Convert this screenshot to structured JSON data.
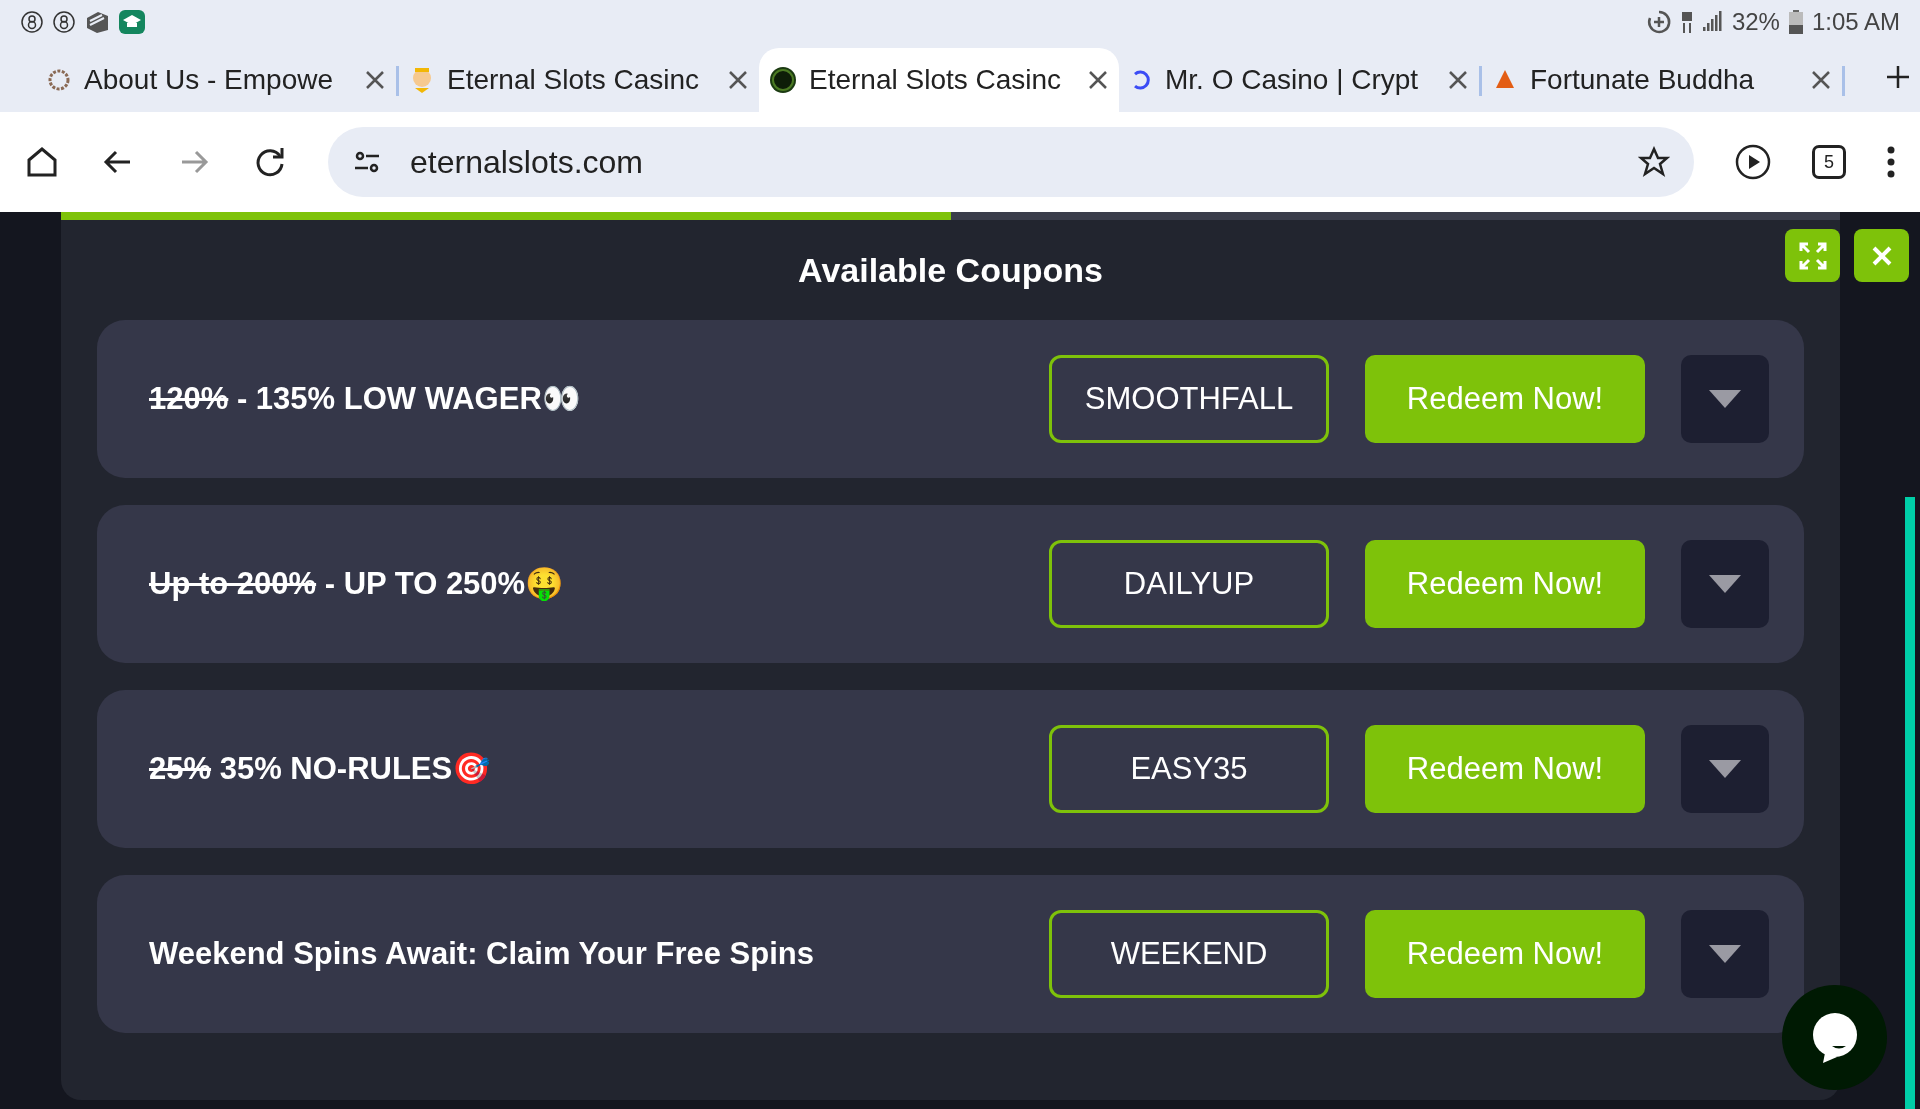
{
  "status_bar": {
    "battery": "32%",
    "time": "1:05 AM"
  },
  "tabs": [
    {
      "title": "About Us - Empowe",
      "selected": false
    },
    {
      "title": "Eternal Slots Casinc",
      "selected": false
    },
    {
      "title": "Eternal Slots Casinc",
      "selected": true
    },
    {
      "title": "Mr. O Casino | Crypt",
      "selected": false
    },
    {
      "title": "Fortunate Buddha",
      "selected": false
    }
  ],
  "address_bar": {
    "url": "eternalslots.com",
    "tab_count": "5"
  },
  "modal": {
    "progress": {
      "level": 0.5
    },
    "title": "Available Coupons",
    "coupons": [
      {
        "old": "120%",
        "title": " - 135% LOW WAGER👀",
        "code": "SMOOTHFALL",
        "button": "Redeem Now!"
      },
      {
        "old": "Up to 200%",
        "title": " - UP TO 250%🤑",
        "code": "DAILYUP",
        "button": "Redeem Now!"
      },
      {
        "old": "25%",
        "title": " 35% NO-RULES🎯",
        "code": "EASY35",
        "button": "Redeem Now!"
      },
      {
        "title": "Weekend Spins Await: Claim Your Free Spins",
        "code": "WEEKEND",
        "button": "Redeem Now!"
      }
    ]
  }
}
